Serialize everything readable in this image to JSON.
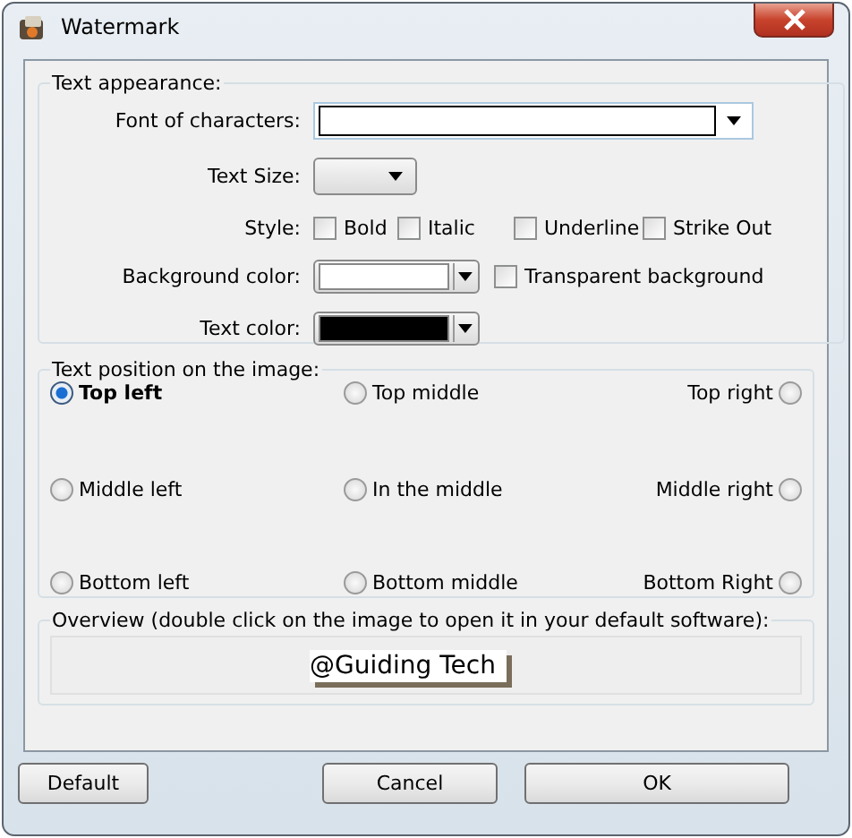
{
  "window": {
    "title": "Watermark"
  },
  "text_appearance": {
    "title": "Text appearance:",
    "font": {
      "label": "Font of characters:"
    },
    "text_size": {
      "label": "Text Size:"
    },
    "style": {
      "label": "Style:",
      "options": [
        {
          "label": "Bold",
          "checked": false
        },
        {
          "label": "Italic",
          "checked": false
        },
        {
          "label": "Underline",
          "checked": false
        },
        {
          "label": "Strike Out",
          "checked": false
        }
      ]
    },
    "background_color": {
      "label": "Background color:",
      "color": "#ffffff"
    },
    "transparent_background": {
      "label": "Transparent background",
      "checked": false
    },
    "text_color": {
      "label": "Text color:",
      "color": "#000000"
    }
  },
  "text_position": {
    "title": "Text position on the image:",
    "options": [
      {
        "label": "Top left",
        "selected": true
      },
      {
        "label": "Top middle",
        "selected": false
      },
      {
        "label": "Top right",
        "selected": false
      },
      {
        "label": "Middle left",
        "selected": false
      },
      {
        "label": "In the middle",
        "selected": false
      },
      {
        "label": "Middle right",
        "selected": false
      },
      {
        "label": "Bottom left",
        "selected": false
      },
      {
        "label": "Bottom middle",
        "selected": false
      },
      {
        "label": "Bottom Right",
        "selected": false
      }
    ]
  },
  "overview": {
    "title": "Overview (double click on the image to open it in your default software):",
    "preview_text": "@Guiding Tech"
  },
  "buttons": [
    {
      "label": "Default"
    },
    {
      "label": "Cancel"
    },
    {
      "label": "OK"
    }
  ]
}
